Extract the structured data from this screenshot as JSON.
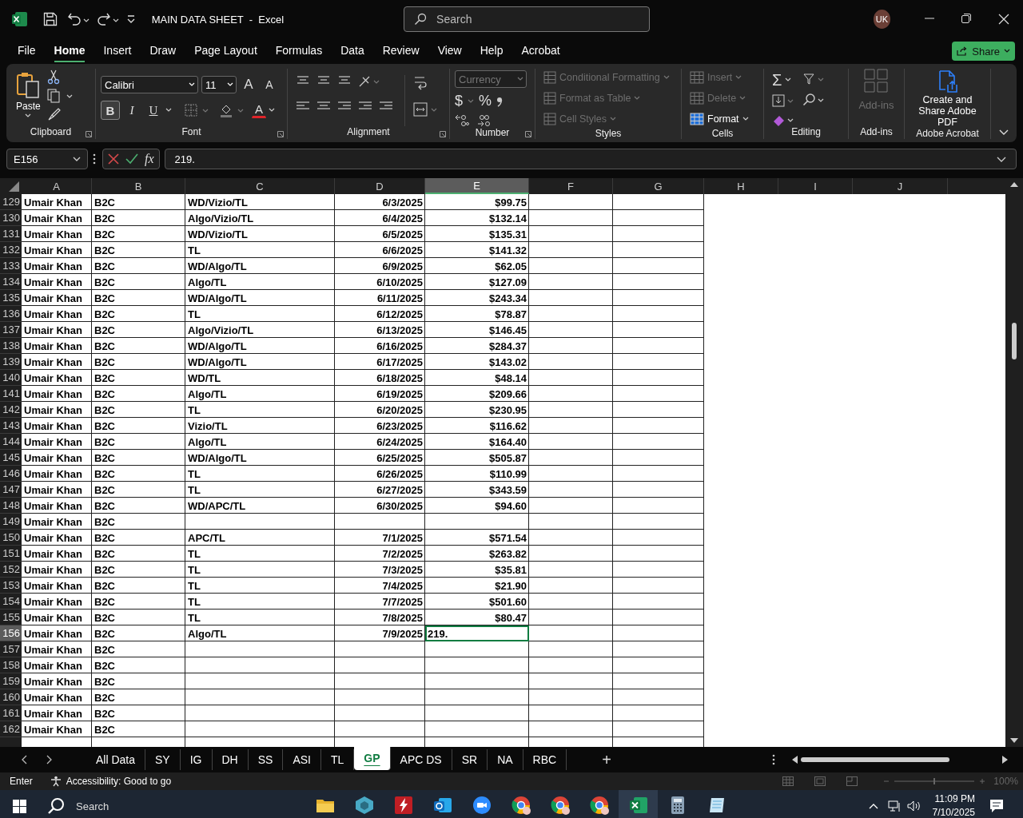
{
  "window": {
    "title": "MAIN DATA SHEET  -  Excel",
    "search_placeholder": "Search",
    "avatar": "UK"
  },
  "menu_tabs": [
    {
      "label": "File",
      "selected": false
    },
    {
      "label": "Home",
      "selected": true
    },
    {
      "label": "Insert",
      "selected": false
    },
    {
      "label": "Draw",
      "selected": false
    },
    {
      "label": "Page Layout",
      "selected": false
    },
    {
      "label": "Formulas",
      "selected": false
    },
    {
      "label": "Data",
      "selected": false
    },
    {
      "label": "Review",
      "selected": false
    },
    {
      "label": "View",
      "selected": false
    },
    {
      "label": "Help",
      "selected": false
    },
    {
      "label": "Acrobat",
      "selected": false
    }
  ],
  "share_button": "Share",
  "ribbon": {
    "clipboard": {
      "paste": "Paste",
      "label": "Clipboard"
    },
    "font": {
      "name": "Calibri",
      "size": "11",
      "grow": "A",
      "shrink": "A",
      "styles": [
        {
          "label": "B",
          "selected": true
        },
        {
          "label": "I",
          "selected": false
        },
        {
          "label": "U",
          "selected": false
        }
      ],
      "color_letter": "A",
      "label": "Font"
    },
    "alignment": {
      "label": "Alignment"
    },
    "number": {
      "format": "Currency",
      "currency": "$",
      "percent": "%",
      "label": "Number"
    },
    "styles": {
      "items": [
        {
          "label": "Conditional Formatting",
          "disabled": true
        },
        {
          "label": "Format as Table",
          "disabled": true
        },
        {
          "label": "Cell Styles",
          "disabled": true
        }
      ],
      "label": "Styles"
    },
    "cells": {
      "items": [
        {
          "label": "Insert",
          "disabled": true
        },
        {
          "label": "Delete",
          "disabled": true
        },
        {
          "label": "Format",
          "disabled": false
        }
      ],
      "label": "Cells"
    },
    "editing": {
      "sum": "Σ",
      "label": "Editing"
    },
    "addins": {
      "button": "Add-ins",
      "disabled": true,
      "label": "Add-ins"
    },
    "acrobat": {
      "button": "Create and Share Adobe PDF",
      "label": "Adobe Acrobat"
    }
  },
  "formula_bar": {
    "name_box": "E156",
    "fx": "fx",
    "value": "219."
  },
  "columns": [
    {
      "label": "A",
      "selected": false
    },
    {
      "label": "B",
      "selected": false
    },
    {
      "label": "C",
      "selected": false
    },
    {
      "label": "D",
      "selected": false
    },
    {
      "label": "E",
      "selected": true
    },
    {
      "label": "F",
      "selected": false
    },
    {
      "label": "G",
      "selected": false
    },
    {
      "label": "H",
      "selected": false
    },
    {
      "label": "I",
      "selected": false
    },
    {
      "label": "J",
      "selected": false
    }
  ],
  "rows": [
    {
      "number": "129",
      "selected": false,
      "cells": [
        "Umair Khan",
        "B2C",
        "WD/Vizio/TL",
        "6/3/2025",
        "$99.75"
      ]
    },
    {
      "number": "130",
      "selected": false,
      "cells": [
        "Umair Khan",
        "B2C",
        "Algo/Vizio/TL",
        "6/4/2025",
        "$132.14"
      ]
    },
    {
      "number": "131",
      "selected": false,
      "cells": [
        "Umair Khan",
        "B2C",
        "WD/Vizio/TL",
        "6/5/2025",
        "$135.31"
      ]
    },
    {
      "number": "132",
      "selected": false,
      "cells": [
        "Umair Khan",
        "B2C",
        "TL",
        "6/6/2025",
        "$141.32"
      ]
    },
    {
      "number": "133",
      "selected": false,
      "cells": [
        "Umair Khan",
        "B2C",
        "WD/Algo/TL",
        "6/9/2025",
        "$62.05"
      ]
    },
    {
      "number": "134",
      "selected": false,
      "cells": [
        "Umair Khan",
        "B2C",
        "Algo/TL",
        "6/10/2025",
        "$127.09"
      ]
    },
    {
      "number": "135",
      "selected": false,
      "cells": [
        "Umair Khan",
        "B2C",
        "WD/Algo/TL",
        "6/11/2025",
        "$243.34"
      ]
    },
    {
      "number": "136",
      "selected": false,
      "cells": [
        "Umair Khan",
        "B2C",
        "TL",
        "6/12/2025",
        "$78.87"
      ]
    },
    {
      "number": "137",
      "selected": false,
      "cells": [
        "Umair Khan",
        "B2C",
        "Algo/Vizio/TL",
        "6/13/2025",
        "$146.45"
      ]
    },
    {
      "number": "138",
      "selected": false,
      "cells": [
        "Umair Khan",
        "B2C",
        "WD/Algo/TL",
        "6/16/2025",
        "$284.37"
      ]
    },
    {
      "number": "139",
      "selected": false,
      "cells": [
        "Umair Khan",
        "B2C",
        "WD/Algo/TL",
        "6/17/2025",
        "$143.02"
      ]
    },
    {
      "number": "140",
      "selected": false,
      "cells": [
        "Umair Khan",
        "B2C",
        "WD/TL",
        "6/18/2025",
        "$48.14"
      ]
    },
    {
      "number": "141",
      "selected": false,
      "cells": [
        "Umair Khan",
        "B2C",
        "Algo/TL",
        "6/19/2025",
        "$209.66"
      ]
    },
    {
      "number": "142",
      "selected": false,
      "cells": [
        "Umair Khan",
        "B2C",
        "TL",
        "6/20/2025",
        "$230.95"
      ]
    },
    {
      "number": "143",
      "selected": false,
      "cells": [
        "Umair Khan",
        "B2C",
        "Vizio/TL",
        "6/23/2025",
        "$116.62"
      ]
    },
    {
      "number": "144",
      "selected": false,
      "cells": [
        "Umair Khan",
        "B2C",
        "Algo/TL",
        "6/24/2025",
        "$164.40"
      ]
    },
    {
      "number": "145",
      "selected": false,
      "cells": [
        "Umair Khan",
        "B2C",
        "WD/Algo/TL",
        "6/25/2025",
        "$505.87"
      ]
    },
    {
      "number": "146",
      "selected": false,
      "cells": [
        "Umair Khan",
        "B2C",
        "TL",
        "6/26/2025",
        "$110.99"
      ]
    },
    {
      "number": "147",
      "selected": false,
      "cells": [
        "Umair Khan",
        "B2C",
        "TL",
        "6/27/2025",
        "$343.59"
      ]
    },
    {
      "number": "148",
      "selected": false,
      "cells": [
        "Umair Khan",
        "B2C",
        "WD/APC/TL",
        "6/30/2025",
        "$94.60"
      ]
    },
    {
      "number": "149",
      "selected": false,
      "cells": [
        "Umair Khan",
        "B2C"
      ]
    },
    {
      "number": "150",
      "selected": false,
      "cells": [
        "Umair Khan",
        "B2C",
        "APC/TL",
        "7/1/2025",
        "$571.54"
      ]
    },
    {
      "number": "151",
      "selected": false,
      "cells": [
        "Umair Khan",
        "B2C",
        "TL",
        "7/2/2025",
        "$263.82"
      ]
    },
    {
      "number": "152",
      "selected": false,
      "cells": [
        "Umair Khan",
        "B2C",
        "TL",
        "7/3/2025",
        "$35.81"
      ]
    },
    {
      "number": "153",
      "selected": false,
      "cells": [
        "Umair Khan",
        "B2C",
        "TL",
        "7/4/2025",
        "$21.90"
      ]
    },
    {
      "number": "154",
      "selected": false,
      "cells": [
        "Umair Khan",
        "B2C",
        "TL",
        "7/7/2025",
        "$501.60"
      ]
    },
    {
      "number": "155",
      "selected": false,
      "cells": [
        "Umair Khan",
        "B2C",
        "TL",
        "7/8/2025",
        "$80.47"
      ]
    },
    {
      "number": "156",
      "selected": true,
      "cells": [
        "Umair Khan",
        "B2C",
        "Algo/TL",
        "7/9/2025",
        "219."
      ]
    },
    {
      "number": "157",
      "selected": false,
      "cells": [
        "Umair Khan",
        "B2C"
      ]
    },
    {
      "number": "158",
      "selected": false,
      "cells": [
        "Umair Khan",
        "B2C"
      ]
    },
    {
      "number": "159",
      "selected": false,
      "cells": [
        "Umair Khan",
        "B2C"
      ]
    },
    {
      "number": "160",
      "selected": false,
      "cells": [
        "Umair Khan",
        "B2C"
      ]
    },
    {
      "number": "161",
      "selected": false,
      "cells": [
        "Umair Khan",
        "B2C"
      ]
    },
    {
      "number": "162",
      "selected": false,
      "cells": [
        "Umair Khan",
        "B2C"
      ]
    }
  ],
  "sheet_tabs": [
    {
      "label": "All Data",
      "selected": false
    },
    {
      "label": "SY",
      "selected": false
    },
    {
      "label": "IG",
      "selected": false
    },
    {
      "label": "DH",
      "selected": false
    },
    {
      "label": "SS",
      "selected": false
    },
    {
      "label": "ASI",
      "selected": false
    },
    {
      "label": "TL",
      "selected": false
    },
    {
      "label": "GP",
      "selected": true
    },
    {
      "label": "APC DS",
      "selected": false
    },
    {
      "label": "SR",
      "selected": false
    },
    {
      "label": "NA",
      "selected": false
    },
    {
      "label": "RBC",
      "selected": false
    }
  ],
  "add_sheet": "+",
  "status_bar": {
    "mode": "Enter",
    "accessibility": "Accessibility: Good to go",
    "zoom": "100%",
    "zoom_slider": {
      "level": 0.5
    }
  },
  "taskbar": {
    "search": "Search",
    "apps": [
      {
        "kind": "folder",
        "active": false
      },
      {
        "kind": "cube",
        "active": false
      },
      {
        "kind": "ftp",
        "active": false
      },
      {
        "kind": "mail",
        "active": false
      },
      {
        "kind": "video",
        "active": false
      },
      {
        "kind": "browser",
        "active": false
      },
      {
        "kind": "browser",
        "active": false
      },
      {
        "kind": "browser",
        "active": false
      },
      {
        "kind": "excel",
        "active": true
      },
      {
        "kind": "calculator",
        "active": false
      },
      {
        "kind": "notepad",
        "active": false
      }
    ],
    "time": "11:09 PM",
    "date": "7/10/2025"
  }
}
